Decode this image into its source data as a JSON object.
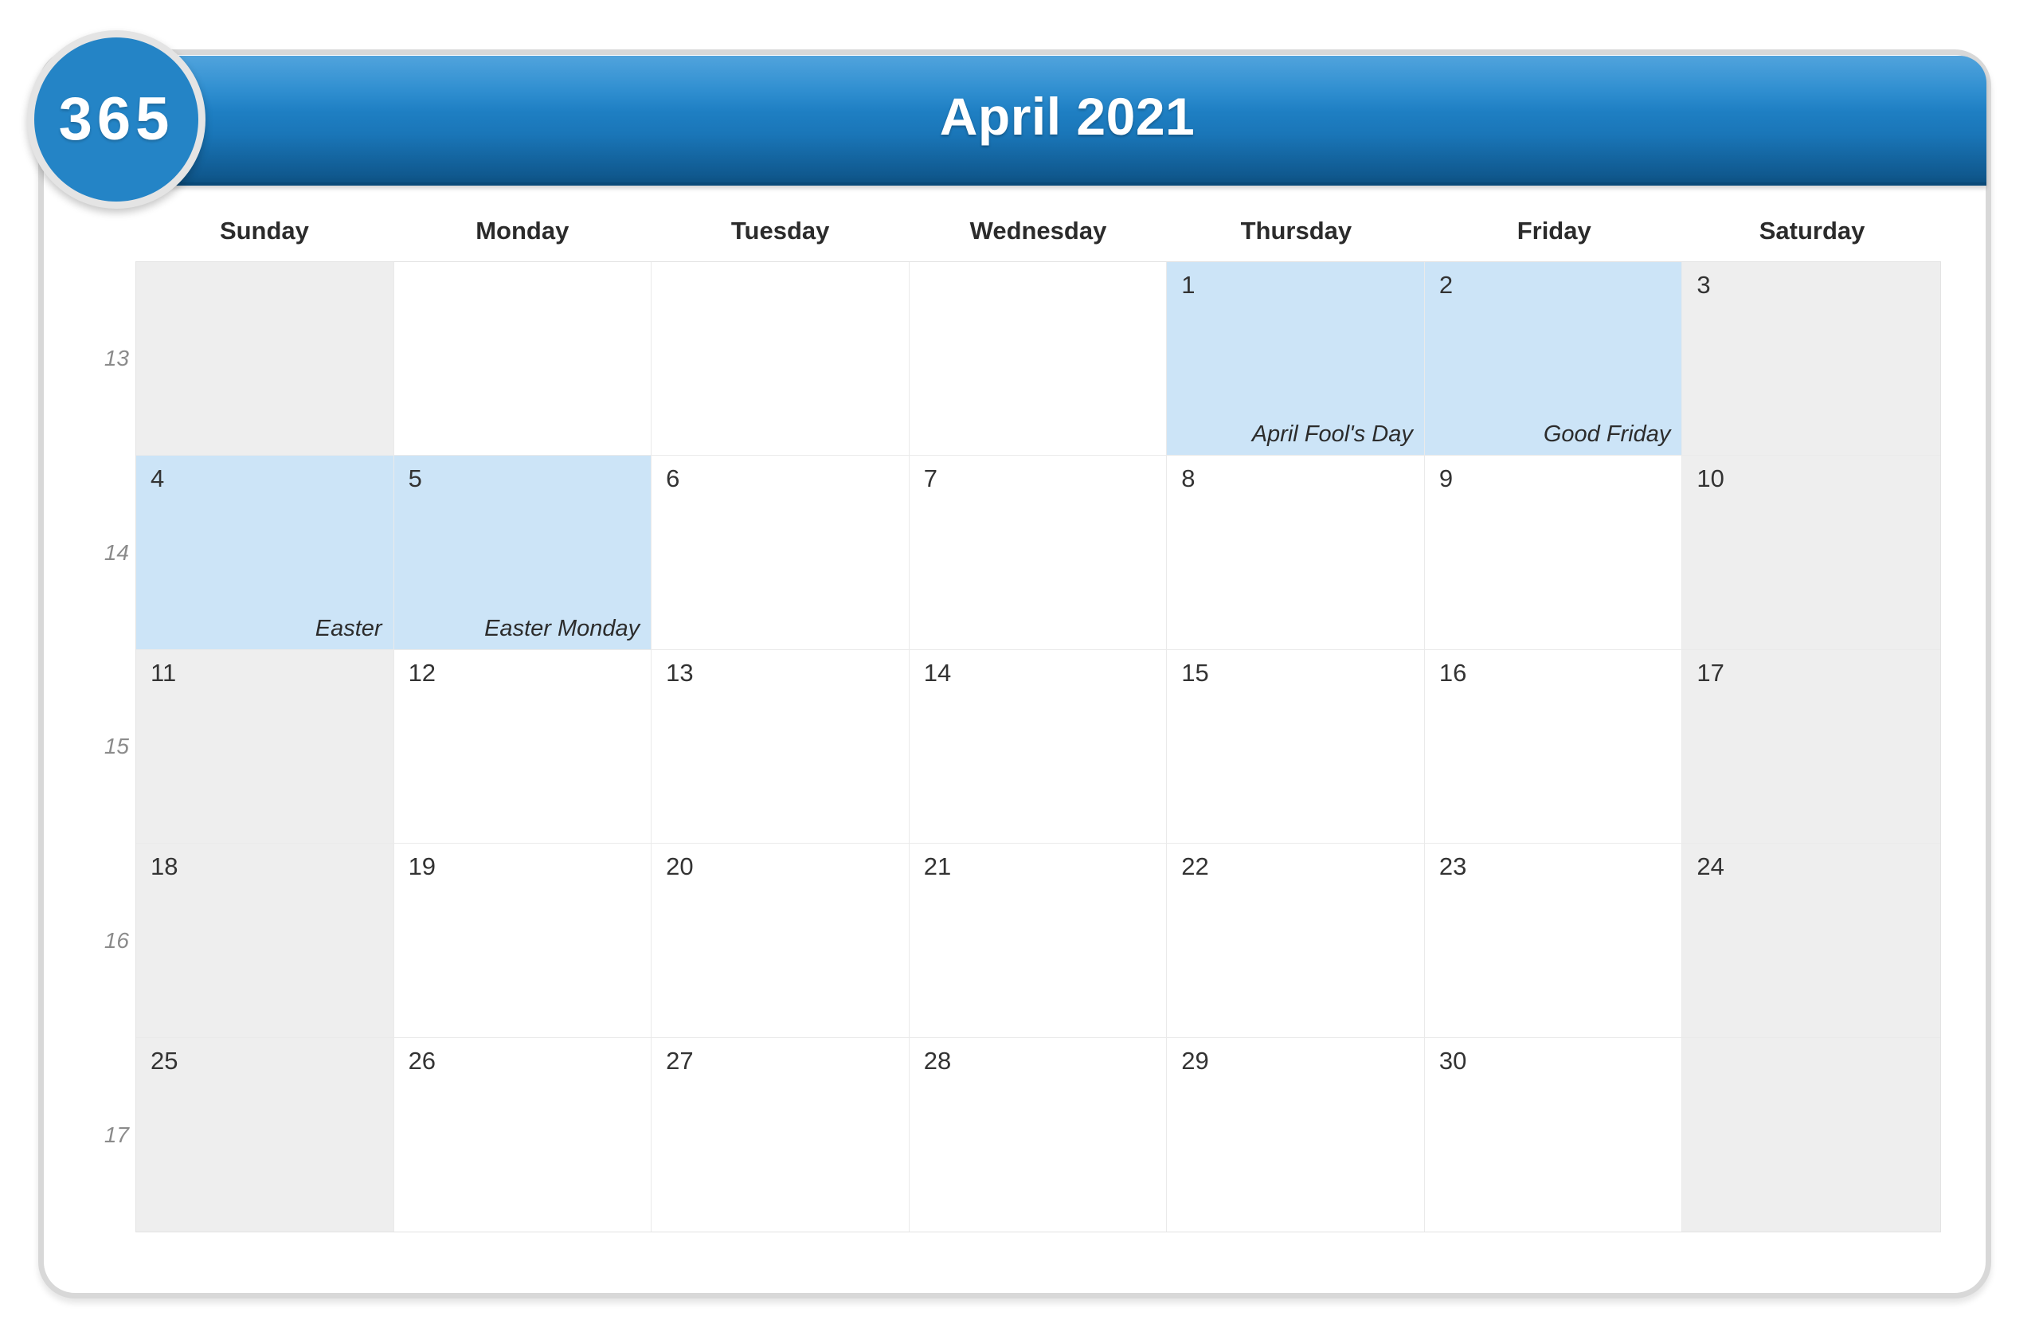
{
  "brand": {
    "logo_text": "365",
    "watermark_text": "365"
  },
  "header": {
    "title": "April 2021"
  },
  "colors": {
    "header_gradient_top": "#2f92d6",
    "header_gradient_bottom": "#0d5283",
    "logo_circle": "#2484c6",
    "holiday_highlight": "#cce4f7",
    "weekend_shade": "#eeeeee",
    "card_border": "#d8d8d8",
    "daynum_text": "#333333",
    "weeknum_text": "#8b8b8b"
  },
  "day_names": [
    "Sunday",
    "Monday",
    "Tuesday",
    "Wednesday",
    "Thursday",
    "Friday",
    "Saturday"
  ],
  "week_numbers": [
    "13",
    "14",
    "15",
    "16",
    "17"
  ],
  "weeks": [
    {
      "week_number": "13",
      "days": [
        {
          "date": "",
          "label": "",
          "weekend": true,
          "holiday": false,
          "blank": true
        },
        {
          "date": "",
          "label": "",
          "weekend": false,
          "holiday": false,
          "blank": true
        },
        {
          "date": "",
          "label": "",
          "weekend": false,
          "holiday": false,
          "blank": true
        },
        {
          "date": "",
          "label": "",
          "weekend": false,
          "holiday": false,
          "blank": true
        },
        {
          "date": "1",
          "label": "April Fool's Day",
          "weekend": false,
          "holiday": true,
          "blank": false
        },
        {
          "date": "2",
          "label": "Good Friday",
          "weekend": false,
          "holiday": true,
          "blank": false
        },
        {
          "date": "3",
          "label": "",
          "weekend": true,
          "holiday": false,
          "blank": false
        }
      ]
    },
    {
      "week_number": "14",
      "days": [
        {
          "date": "4",
          "label": "Easter",
          "weekend": true,
          "holiday": true,
          "blank": false
        },
        {
          "date": "5",
          "label": "Easter Monday",
          "weekend": false,
          "holiday": true,
          "blank": false
        },
        {
          "date": "6",
          "label": "",
          "weekend": false,
          "holiday": false,
          "blank": false
        },
        {
          "date": "7",
          "label": "",
          "weekend": false,
          "holiday": false,
          "blank": false
        },
        {
          "date": "8",
          "label": "",
          "weekend": false,
          "holiday": false,
          "blank": false
        },
        {
          "date": "9",
          "label": "",
          "weekend": false,
          "holiday": false,
          "blank": false
        },
        {
          "date": "10",
          "label": "",
          "weekend": true,
          "holiday": false,
          "blank": false
        }
      ]
    },
    {
      "week_number": "15",
      "days": [
        {
          "date": "11",
          "label": "",
          "weekend": true,
          "holiday": false,
          "blank": false
        },
        {
          "date": "12",
          "label": "",
          "weekend": false,
          "holiday": false,
          "blank": false
        },
        {
          "date": "13",
          "label": "",
          "weekend": false,
          "holiday": false,
          "blank": false
        },
        {
          "date": "14",
          "label": "",
          "weekend": false,
          "holiday": false,
          "blank": false
        },
        {
          "date": "15",
          "label": "",
          "weekend": false,
          "holiday": false,
          "blank": false
        },
        {
          "date": "16",
          "label": "",
          "weekend": false,
          "holiday": false,
          "blank": false
        },
        {
          "date": "17",
          "label": "",
          "weekend": true,
          "holiday": false,
          "blank": false
        }
      ]
    },
    {
      "week_number": "16",
      "days": [
        {
          "date": "18",
          "label": "",
          "weekend": true,
          "holiday": false,
          "blank": false
        },
        {
          "date": "19",
          "label": "",
          "weekend": false,
          "holiday": false,
          "blank": false
        },
        {
          "date": "20",
          "label": "",
          "weekend": false,
          "holiday": false,
          "blank": false
        },
        {
          "date": "21",
          "label": "",
          "weekend": false,
          "holiday": false,
          "blank": false
        },
        {
          "date": "22",
          "label": "",
          "weekend": false,
          "holiday": false,
          "blank": false
        },
        {
          "date": "23",
          "label": "",
          "weekend": false,
          "holiday": false,
          "blank": false
        },
        {
          "date": "24",
          "label": "",
          "weekend": true,
          "holiday": false,
          "blank": false
        }
      ]
    },
    {
      "week_number": "17",
      "days": [
        {
          "date": "25",
          "label": "",
          "weekend": true,
          "holiday": false,
          "blank": false
        },
        {
          "date": "26",
          "label": "",
          "weekend": false,
          "holiday": false,
          "blank": false
        },
        {
          "date": "27",
          "label": "",
          "weekend": false,
          "holiday": false,
          "blank": false
        },
        {
          "date": "28",
          "label": "",
          "weekend": false,
          "holiday": false,
          "blank": false
        },
        {
          "date": "29",
          "label": "",
          "weekend": false,
          "holiday": false,
          "blank": false
        },
        {
          "date": "30",
          "label": "",
          "weekend": false,
          "holiday": false,
          "blank": false
        },
        {
          "date": "",
          "label": "",
          "weekend": true,
          "holiday": false,
          "blank": true
        }
      ]
    }
  ]
}
